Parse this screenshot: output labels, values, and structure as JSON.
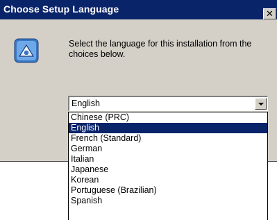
{
  "window": {
    "title": "Choose Setup Language",
    "close_glyph": "✕"
  },
  "icon": "setup-installer-icon",
  "prompt": "Select the language for this installation from the choices below.",
  "language_combo": {
    "value": "English",
    "options": [
      "Chinese (PRC)",
      "English",
      "French (Standard)",
      "German",
      "Italian",
      "Japanese",
      "Korean",
      "Portuguese (Brazilian)",
      "Spanish"
    ],
    "selected_index": 1
  },
  "colors": {
    "titlebar": "#0a246a",
    "dialog_face": "#d4d0c8",
    "selection": "#0a246a"
  }
}
